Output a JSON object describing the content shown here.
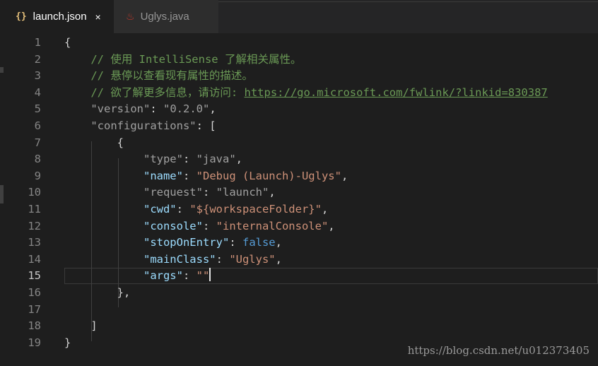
{
  "tabs": [
    {
      "icon": "{}",
      "label": "launch.json",
      "close": "×",
      "active": true
    },
    {
      "icon": "♨",
      "label": "Uglys.java",
      "active": false
    }
  ],
  "editor": {
    "current_line": 15,
    "lines": [
      {
        "num": "1",
        "tokens": [
          {
            "t": "{",
            "c": "punc"
          }
        ]
      },
      {
        "num": "2",
        "tokens": [
          {
            "t": "    // 使用 IntelliSense 了解相关属性。",
            "c": "comment"
          }
        ]
      },
      {
        "num": "3",
        "tokens": [
          {
            "t": "    // 悬停以查看现有属性的描述。",
            "c": "comment"
          }
        ]
      },
      {
        "num": "4",
        "tokens": [
          {
            "t": "    // 欲了解更多信息，请访问: ",
            "c": "comment"
          },
          {
            "t": "https://go.microsoft.com/fwlink/?linkid=830387",
            "c": "link"
          }
        ]
      },
      {
        "num": "5",
        "tokens": [
          {
            "t": "    ",
            "c": "punc"
          },
          {
            "t": "\"version\"",
            "c": "key-dim"
          },
          {
            "t": ": ",
            "c": "punc"
          },
          {
            "t": "\"0.2.0\"",
            "c": "str-dim"
          },
          {
            "t": ",",
            "c": "punc"
          }
        ]
      },
      {
        "num": "6",
        "tokens": [
          {
            "t": "    ",
            "c": "punc"
          },
          {
            "t": "\"configurations\"",
            "c": "key-dim"
          },
          {
            "t": ": [",
            "c": "punc"
          }
        ]
      },
      {
        "num": "7",
        "tokens": [
          {
            "t": "        {",
            "c": "punc"
          }
        ]
      },
      {
        "num": "8",
        "tokens": [
          {
            "t": "            ",
            "c": "punc"
          },
          {
            "t": "\"type\"",
            "c": "key-dim"
          },
          {
            "t": ": ",
            "c": "punc"
          },
          {
            "t": "\"java\"",
            "c": "str-dim"
          },
          {
            "t": ",",
            "c": "punc"
          }
        ]
      },
      {
        "num": "9",
        "tokens": [
          {
            "t": "            ",
            "c": "punc"
          },
          {
            "t": "\"name\"",
            "c": "key"
          },
          {
            "t": ": ",
            "c": "punc"
          },
          {
            "t": "\"Debug (Launch)-Uglys\"",
            "c": "str"
          },
          {
            "t": ",",
            "c": "punc"
          }
        ]
      },
      {
        "num": "10",
        "tokens": [
          {
            "t": "            ",
            "c": "punc"
          },
          {
            "t": "\"request\"",
            "c": "key-dim"
          },
          {
            "t": ": ",
            "c": "punc"
          },
          {
            "t": "\"launch\"",
            "c": "str-dim"
          },
          {
            "t": ",",
            "c": "punc"
          }
        ]
      },
      {
        "num": "11",
        "tokens": [
          {
            "t": "            ",
            "c": "punc"
          },
          {
            "t": "\"cwd\"",
            "c": "key"
          },
          {
            "t": ": ",
            "c": "punc"
          },
          {
            "t": "\"${workspaceFolder}\"",
            "c": "str"
          },
          {
            "t": ",",
            "c": "punc"
          }
        ]
      },
      {
        "num": "12",
        "tokens": [
          {
            "t": "            ",
            "c": "punc"
          },
          {
            "t": "\"console\"",
            "c": "key"
          },
          {
            "t": ": ",
            "c": "punc"
          },
          {
            "t": "\"internalConsole\"",
            "c": "str"
          },
          {
            "t": ",",
            "c": "punc"
          }
        ]
      },
      {
        "num": "13",
        "tokens": [
          {
            "t": "            ",
            "c": "punc"
          },
          {
            "t": "\"stopOnEntry\"",
            "c": "key"
          },
          {
            "t": ": ",
            "c": "punc"
          },
          {
            "t": "false",
            "c": "bool"
          },
          {
            "t": ",",
            "c": "punc"
          }
        ]
      },
      {
        "num": "14",
        "tokens": [
          {
            "t": "            ",
            "c": "punc"
          },
          {
            "t": "\"mainClass\"",
            "c": "key"
          },
          {
            "t": ": ",
            "c": "punc"
          },
          {
            "t": "\"Uglys\"",
            "c": "str"
          },
          {
            "t": ",",
            "c": "punc"
          }
        ]
      },
      {
        "num": "15",
        "tokens": [
          {
            "t": "            ",
            "c": "punc"
          },
          {
            "t": "\"args\"",
            "c": "key"
          },
          {
            "t": ": ",
            "c": "punc"
          },
          {
            "t": "\"\"",
            "c": "str"
          }
        ],
        "cursor": true
      },
      {
        "num": "16",
        "tokens": [
          {
            "t": "        },",
            "c": "punc"
          }
        ]
      },
      {
        "num": "17",
        "tokens": []
      },
      {
        "num": "18",
        "tokens": [
          {
            "t": "    ]",
            "c": "punc"
          }
        ]
      },
      {
        "num": "19",
        "tokens": [
          {
            "t": "}",
            "c": "punc"
          }
        ]
      }
    ]
  },
  "watermark": "https://blog.csdn.net/u012373405",
  "colors": {
    "background": "#1e1e1e",
    "comment": "#6a9955",
    "key": "#9cdcfe",
    "string": "#ce9178",
    "boolean": "#569cd6"
  }
}
